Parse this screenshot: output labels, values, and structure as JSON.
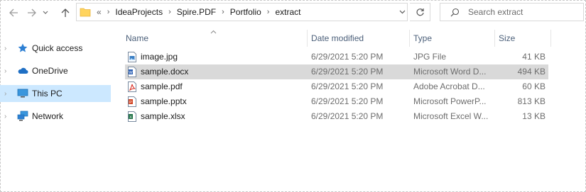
{
  "toolbar": {
    "breadcrumb": [
      "IdeaProjects",
      "Spire.PDF",
      "Portfolio",
      "extract"
    ],
    "overflow": "«",
    "search_placeholder": "Search extract"
  },
  "nav": {
    "items": [
      {
        "label": "Quick access",
        "icon": "star-icon"
      },
      {
        "label": "OneDrive",
        "icon": "cloud-icon"
      },
      {
        "label": "This PC",
        "icon": "computer-icon",
        "selected": true
      },
      {
        "label": "Network",
        "icon": "network-icon"
      }
    ]
  },
  "list": {
    "headers": {
      "name": "Name",
      "date": "Date modified",
      "type": "Type",
      "size": "Size"
    },
    "rows": [
      {
        "name": "image.jpg",
        "date": "6/29/2021 5:20 PM",
        "type": "JPG File",
        "size": "41 KB",
        "icon": "image-file-icon"
      },
      {
        "name": "sample.docx",
        "date": "6/29/2021 5:20 PM",
        "type": "Microsoft Word D...",
        "size": "494 KB",
        "icon": "word-file-icon",
        "selected": true
      },
      {
        "name": "sample.pdf",
        "date": "6/29/2021 5:20 PM",
        "type": "Adobe Acrobat D...",
        "size": "60 KB",
        "icon": "pdf-file-icon"
      },
      {
        "name": "sample.pptx",
        "date": "6/29/2021 5:20 PM",
        "type": "Microsoft PowerP...",
        "size": "813 KB",
        "icon": "powerpoint-file-icon"
      },
      {
        "name": "sample.xlsx",
        "date": "6/29/2021 5:20 PM",
        "type": "Microsoft Excel W...",
        "size": "13 KB",
        "icon": "excel-file-icon"
      }
    ]
  },
  "colors": {
    "selected_nav": "#cce8ff",
    "selected_row": "#d9d9d9",
    "header_text": "#4c607a"
  }
}
